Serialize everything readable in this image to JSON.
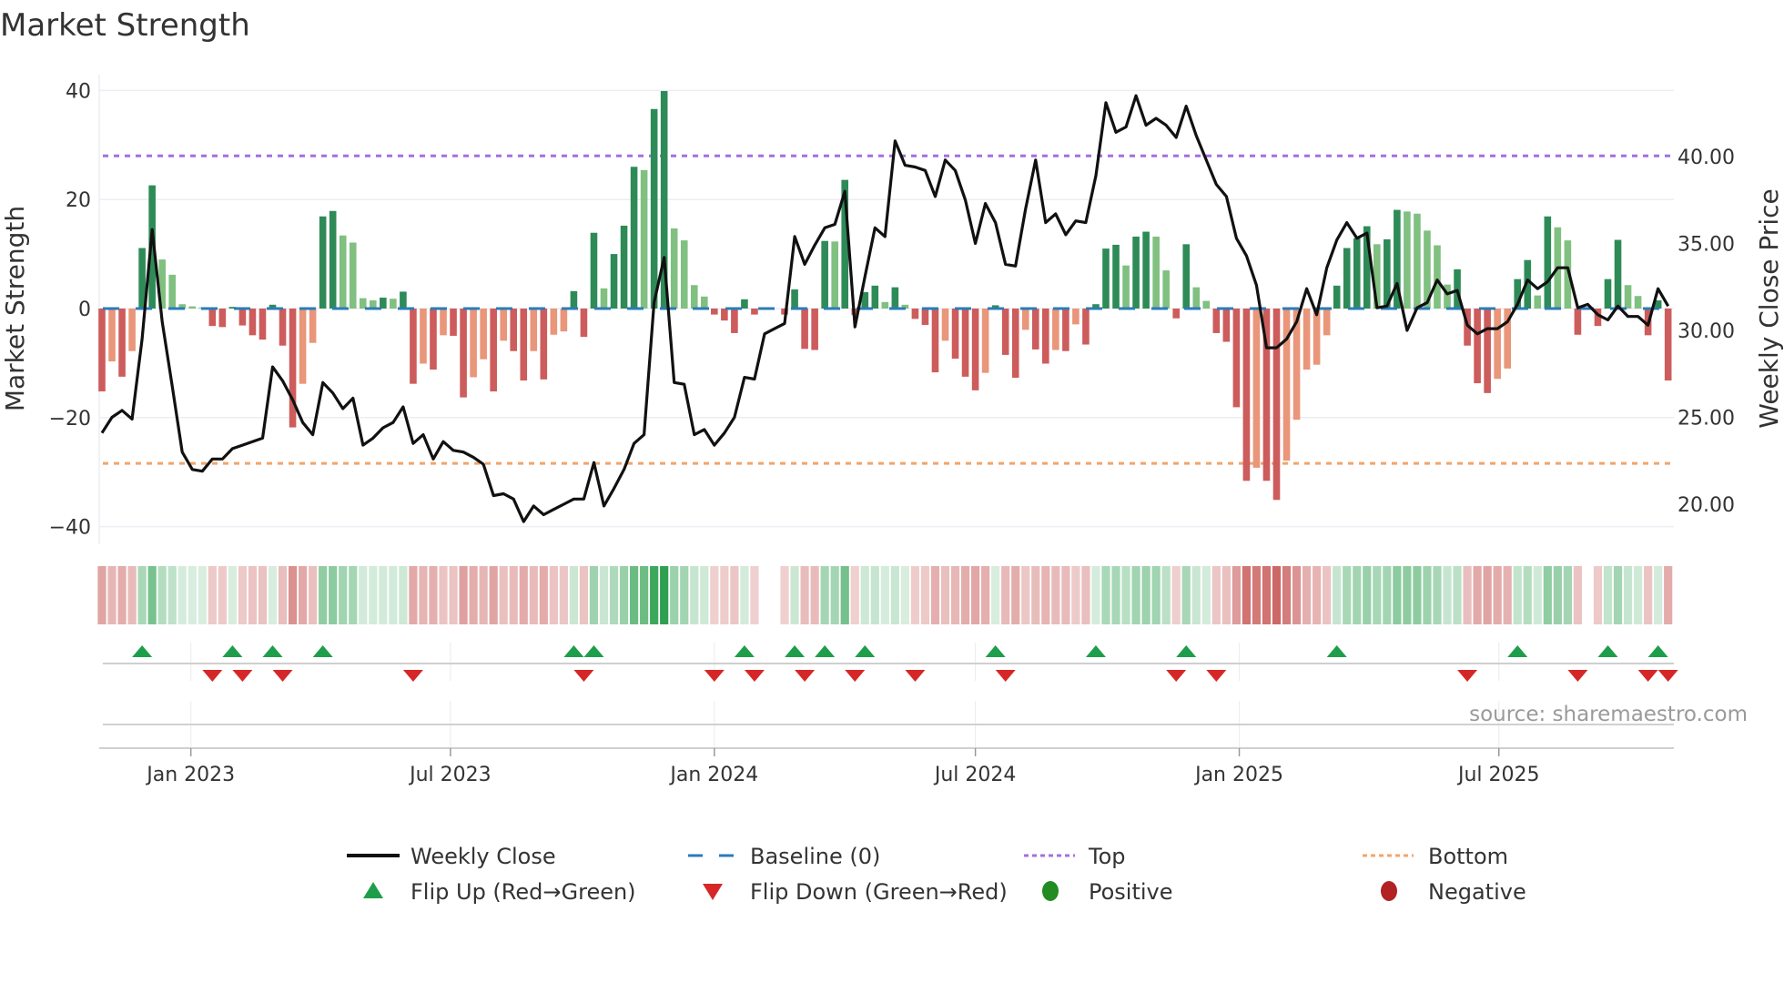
{
  "chart_data": {
    "type": "bar",
    "title": "Market Strength",
    "ylabel": "Market Strength",
    "y2label": "Weekly Close Price",
    "ylim": [
      -42,
      42
    ],
    "y2lim": [
      17.5,
      44.0
    ],
    "y_ticks": [
      "40",
      "20",
      "0",
      "−20",
      "−40"
    ],
    "y_tick_values": [
      40,
      20,
      0,
      -20,
      -40
    ],
    "y2_ticks": [
      "40.00",
      "35.00",
      "30.00",
      "25.00",
      "20.00"
    ],
    "y2_tick_values": [
      40,
      35,
      30,
      25,
      20
    ],
    "x_ticks": [
      {
        "label": "Jan 2023",
        "date": "2023-01-01"
      },
      {
        "label": "Jul 2023",
        "date": "2023-07-01"
      },
      {
        "label": "Jan 2024",
        "date": "2024-01-01"
      },
      {
        "label": "Jul 2024",
        "date": "2024-07-01"
      },
      {
        "label": "Jan 2025",
        "date": "2025-01-01"
      },
      {
        "label": "Jul 2025",
        "date": "2025-07-01"
      }
    ],
    "start_date": "2022-10-31",
    "frequency": "weekly",
    "grid": true,
    "top_level": 28,
    "bottom_level": -28.4,
    "baseline": 0,
    "strength": [
      -15.2,
      -9.7,
      -12.5,
      -7.8,
      11.1,
      22.6,
      9.0,
      6.2,
      0.8,
      0.4,
      0.2,
      -3.2,
      -3.4,
      0.3,
      -3.1,
      -4.9,
      -5.7,
      0.7,
      -6.8,
      -21.8,
      -13.8,
      -6.3,
      16.9,
      17.9,
      13.4,
      12.1,
      1.9,
      1.5,
      2.0,
      1.8,
      3.1,
      -13.8,
      -10.1,
      -11.2,
      -4.9,
      -5.0,
      -16.3,
      -12.6,
      -9.3,
      -15.2,
      -5.9,
      -7.8,
      -13.2,
      -7.8,
      -13.0,
      -4.8,
      -4.2,
      3.2,
      -5.2,
      13.9,
      3.7,
      10.0,
      15.2,
      26.0,
      25.4,
      36.6,
      39.9,
      14.7,
      12.5,
      4.3,
      2.2,
      -1.1,
      -2.2,
      -4.5,
      1.7,
      -1.1,
      0,
      0,
      -1.1,
      3.5,
      -7.4,
      -7.6,
      12.4,
      12.3,
      23.6,
      -1.2,
      3.0,
      4.2,
      1.2,
      3.9,
      0.7,
      -1.9,
      -3.0,
      -11.7,
      -5.9,
      -9.2,
      -12.5,
      -15.0,
      -11.8,
      0.6,
      -8.5,
      -12.7,
      -3.9,
      -7.5,
      -10.1,
      -7.6,
      -7.8,
      -2.9,
      -6.6,
      0.8,
      11.0,
      11.7,
      7.9,
      13.2,
      14.1,
      13.2,
      7.0,
      -1.8,
      11.8,
      3.9,
      1.4,
      -4.5,
      -6.1,
      -18.1,
      -31.6,
      -29.2,
      -31.6,
      -35.1,
      -27.9,
      -20.4,
      -11.2,
      -10.3,
      -4.9,
      4.2,
      11.1,
      12.9,
      15.1,
      11.8,
      12.7,
      18.1,
      17.8,
      17.4,
      14.3,
      11.6,
      4.4,
      7.2,
      -6.8,
      -13.7,
      -15.5,
      -12.9,
      -11.0,
      5.4,
      8.9,
      2.4,
      16.9,
      14.9,
      12.5,
      -4.8,
      0,
      -3.2,
      5.4,
      12.6,
      4.3,
      2.3,
      -4.9,
      1.5,
      -13.2
    ],
    "weekly_close": [
      24.1,
      25.0,
      25.4,
      24.9,
      29.5,
      35.8,
      30.5,
      26.8,
      23.0,
      22.0,
      21.9,
      22.6,
      22.6,
      23.2,
      23.4,
      23.6,
      23.8,
      27.9,
      27.1,
      26.0,
      24.7,
      24.0,
      27.0,
      26.4,
      25.5,
      26.1,
      23.4,
      23.8,
      24.4,
      24.7,
      25.6,
      23.5,
      24.0,
      22.6,
      23.6,
      23.1,
      23.0,
      22.7,
      22.3,
      20.5,
      20.6,
      20.3,
      19.0,
      19.9,
      19.4,
      19.7,
      20.0,
      20.3,
      20.3,
      22.4,
      19.9,
      20.9,
      22.0,
      23.5,
      24.0,
      31.6,
      34.2,
      27.0,
      26.9,
      24.0,
      24.3,
      23.4,
      24.1,
      25.0,
      27.3,
      27.2,
      29.8,
      30.1,
      30.4,
      35.4,
      33.8,
      34.9,
      35.9,
      36.1,
      38.0,
      30.2,
      33.1,
      35.9,
      35.4,
      40.9,
      39.5,
      39.4,
      39.2,
      37.7,
      39.8,
      39.2,
      37.5,
      35.0,
      37.3,
      36.2,
      33.8,
      33.7,
      37.0,
      39.8,
      36.2,
      36.7,
      35.5,
      36.3,
      36.2,
      38.9,
      43.1,
      41.4,
      41.7,
      43.5,
      41.8,
      42.2,
      41.8,
      41.1,
      42.9,
      41.2,
      39.8,
      38.4,
      37.7,
      35.3,
      34.3,
      32.6,
      29.0,
      29.0,
      29.5,
      30.5,
      32.4,
      30.9,
      33.6,
      35.2,
      36.2,
      35.3,
      35.6,
      31.3,
      31.4,
      32.7,
      30.0,
      31.3,
      31.6,
      32.9,
      32.1,
      32.3,
      30.3,
      29.8,
      30.1,
      30.1,
      30.5,
      31.5,
      32.9,
      32.4,
      32.8,
      33.6,
      33.6,
      31.3,
      31.5,
      30.9,
      30.6,
      31.4,
      30.8,
      30.8,
      30.3,
      32.4,
      31.4
    ],
    "legend": {
      "placement": "bottom",
      "items": [
        {
          "label": "Weekly Close",
          "kind": "line",
          "color": "#111111"
        },
        {
          "label": "Baseline (0)",
          "kind": "dash",
          "color": "#2b7bb9"
        },
        {
          "label": "Top",
          "kind": "dot",
          "color": "#a46ee0"
        },
        {
          "label": "Bottom",
          "kind": "dot",
          "color": "#f2a56a"
        },
        {
          "label": "Flip Up (Red→Green)",
          "kind": "tri-up",
          "color": "#1e9e4a"
        },
        {
          "label": "Flip Down (Green→Red)",
          "kind": "tri-down",
          "color": "#d62728"
        },
        {
          "label": "Positive",
          "kind": "circle",
          "color": "#228b22"
        },
        {
          "label": "Negative",
          "kind": "circle",
          "color": "#b22222"
        }
      ]
    },
    "colors": {
      "pos_strong": "#2e8b57",
      "pos_weak": "#80c080",
      "neg_strong": "#cd5c5c",
      "neg_weak": "#e9967a",
      "flip_up": "#1e9e4a",
      "flip_down": "#d62728"
    },
    "source": "source: sharemaestro.com"
  }
}
